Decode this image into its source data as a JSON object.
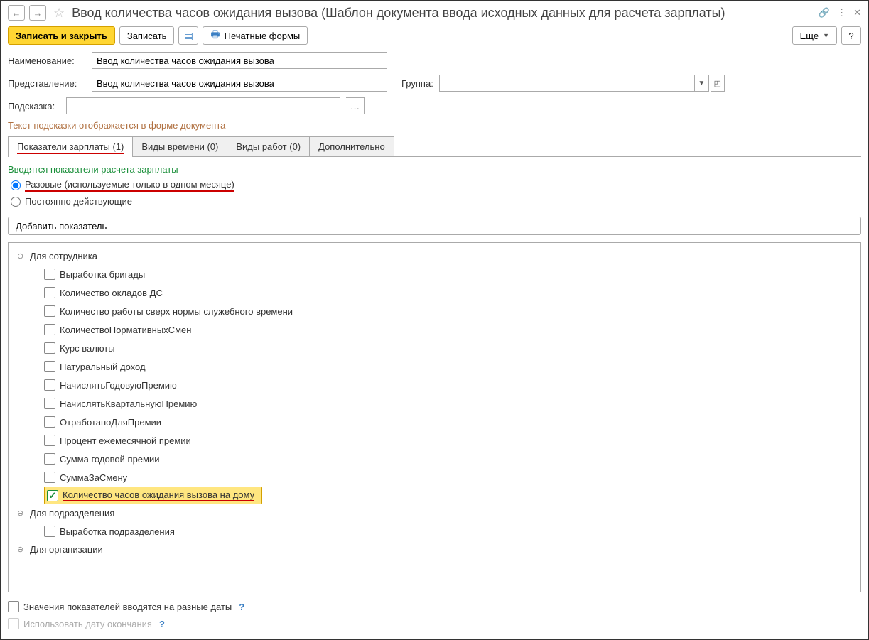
{
  "title": "Ввод количества часов ожидания вызова (Шаблон документа ввода исходных данных для расчета зарплаты)",
  "toolbar": {
    "save_close": "Записать и закрыть",
    "save": "Записать",
    "print_forms": "Печатные формы",
    "more": "Еще",
    "help": "?"
  },
  "form": {
    "name_label": "Наименование:",
    "name_value": "Ввод количества часов ожидания вызова",
    "repr_label": "Представление:",
    "repr_value": "Ввод количества часов ожидания вызова",
    "group_label": "Группа:",
    "group_value": "",
    "hint_label": "Подсказка:",
    "hint_value": "",
    "hint_note": "Текст подсказки отображается в форме документа"
  },
  "tabs": {
    "t0": "Показатели зарплаты (1)",
    "t1": "Виды времени (0)",
    "t2": "Виды работ (0)",
    "t3": "Дополнительно"
  },
  "section": {
    "title": "Вводятся показатели расчета зарплаты",
    "radio_once": "Разовые (используемые только в одном месяце)",
    "radio_perm": "Постоянно действующие",
    "add_btn": "Добавить показатель"
  },
  "tree": {
    "g0": "Для сотрудника",
    "g0_items": {
      "i0": "Выработка бригады",
      "i1": "Количество окладов ДС",
      "i2": "Количество работы сверх нормы служебного времени",
      "i3": "КоличествоНормативныхСмен",
      "i4": "Курс валюты",
      "i5": "Натуральный доход",
      "i6": "НачислятьГодовуюПремию",
      "i7": "НачислятьКвартальнуюПремию",
      "i8": "ОтработаноДляПремии",
      "i9": "Процент ежемесячной премии",
      "i10": "Сумма годовой премии",
      "i11": "СуммаЗаСмену",
      "i12": "Количество часов ожидания вызова на дому"
    },
    "g1": "Для подразделения",
    "g1_items": {
      "i0": "Выработка подразделения"
    },
    "g2": "Для организации"
  },
  "bottom": {
    "c0": "Значения показателей вводятся на разные даты",
    "c1": "Использовать дату окончания"
  }
}
